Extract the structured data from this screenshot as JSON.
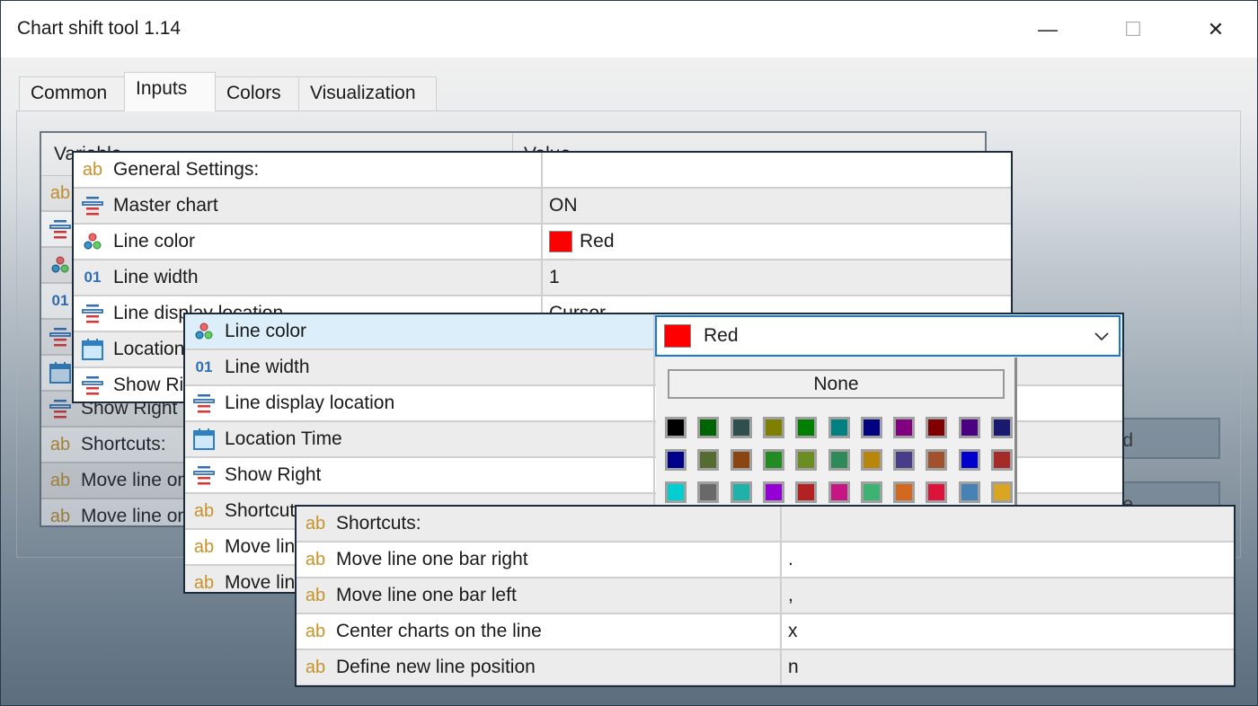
{
  "window": {
    "title": "Chart shift tool 1.14",
    "minimize": "—",
    "maximize": "☐",
    "close": "✕"
  },
  "tabs": [
    {
      "label": "Common"
    },
    {
      "label": "Inputs",
      "selected": true
    },
    {
      "label": "Colors"
    },
    {
      "label": "Visualization"
    }
  ],
  "back_table": {
    "headers": [
      "Variable",
      "Value"
    ],
    "rows": [
      {
        "icon": "ab",
        "label": "General Settings:"
      },
      {
        "icon": "enum",
        "label": "Master chart"
      },
      {
        "icon": "color",
        "label": "Line color"
      },
      {
        "icon": "int",
        "label": "Line width"
      },
      {
        "icon": "enum",
        "label": "Line display location"
      },
      {
        "icon": "date",
        "label": "Location Time"
      },
      {
        "icon": "enum",
        "label": "Show Right"
      },
      {
        "icon": "ab",
        "label": "Shortcuts:"
      },
      {
        "icon": "ab",
        "label": "Move line one bar right"
      },
      {
        "icon": "ab",
        "label": "Move line one bar left"
      }
    ],
    "buttons": [
      "d",
      "e"
    ]
  },
  "panel1": {
    "rows": [
      {
        "icon": "ab",
        "label": "General Settings:",
        "value": ""
      },
      {
        "icon": "enum",
        "label": "Master chart",
        "value": "ON"
      },
      {
        "icon": "color",
        "label": "Line color",
        "value": "Red",
        "swatch": "#ff0000"
      },
      {
        "icon": "int",
        "label": "Line width",
        "value": "1"
      },
      {
        "icon": "enum",
        "label": "Line display location",
        "value": "Cursor"
      },
      {
        "icon": "date",
        "label": "Location Time",
        "value": ""
      },
      {
        "icon": "enum",
        "label": "Show Right",
        "value": ""
      }
    ]
  },
  "panel2": {
    "rows": [
      {
        "icon": "color",
        "label": "Line color",
        "value": ""
      },
      {
        "icon": "int",
        "label": "Line width",
        "value": ""
      },
      {
        "icon": "enum",
        "label": "Line display location",
        "value": ""
      },
      {
        "icon": "date",
        "label": "Location Time",
        "value": ""
      },
      {
        "icon": "enum",
        "label": "Show Right",
        "value": ""
      },
      {
        "icon": "ab",
        "label": "Shortcuts:",
        "value": ""
      },
      {
        "icon": "ab",
        "label": "Move line one bar right",
        "value": ""
      },
      {
        "icon": "ab",
        "label": "Move line one bar left",
        "value": ""
      }
    ],
    "combo": {
      "value": "Red",
      "swatch": "#ff0000",
      "icon": "chevron-down"
    },
    "popup": {
      "none_label": "None",
      "colors": [
        [
          "#000000",
          "#006400",
          "#2F4F4F",
          "#808000",
          "#008000",
          "#008080",
          "#000080",
          "#800080",
          "#800000",
          "#4B0082",
          "#191970"
        ],
        [
          "#00008B",
          "#556B2F",
          "#8B4513",
          "#228B22",
          "#6B8E23",
          "#2E8B57",
          "#B8860B",
          "#483D8B",
          "#A0522D",
          "#0000CD",
          "#A52A2A"
        ],
        [
          "#00CED1",
          "#696969",
          "#20B2AA",
          "#9400D3",
          "#B22222",
          "#C71585",
          "#3CB371",
          "#D2691E",
          "#DC143C",
          "#4682B4",
          "#DAA520"
        ]
      ]
    }
  },
  "panel3": {
    "rows": [
      {
        "icon": "ab",
        "label": "Shortcuts:",
        "value": ""
      },
      {
        "icon": "ab",
        "label": "Move line one bar right",
        "value": "."
      },
      {
        "icon": "ab",
        "label": "Move line one bar left",
        "value": ","
      },
      {
        "icon": "ab",
        "label": "Center charts on the line",
        "value": "x"
      },
      {
        "icon": "ab",
        "label": "Define new line position",
        "value": "n"
      }
    ]
  },
  "colors": {
    "highlight_row": "#ddeefb",
    "combo_border": "#1a78d0"
  }
}
